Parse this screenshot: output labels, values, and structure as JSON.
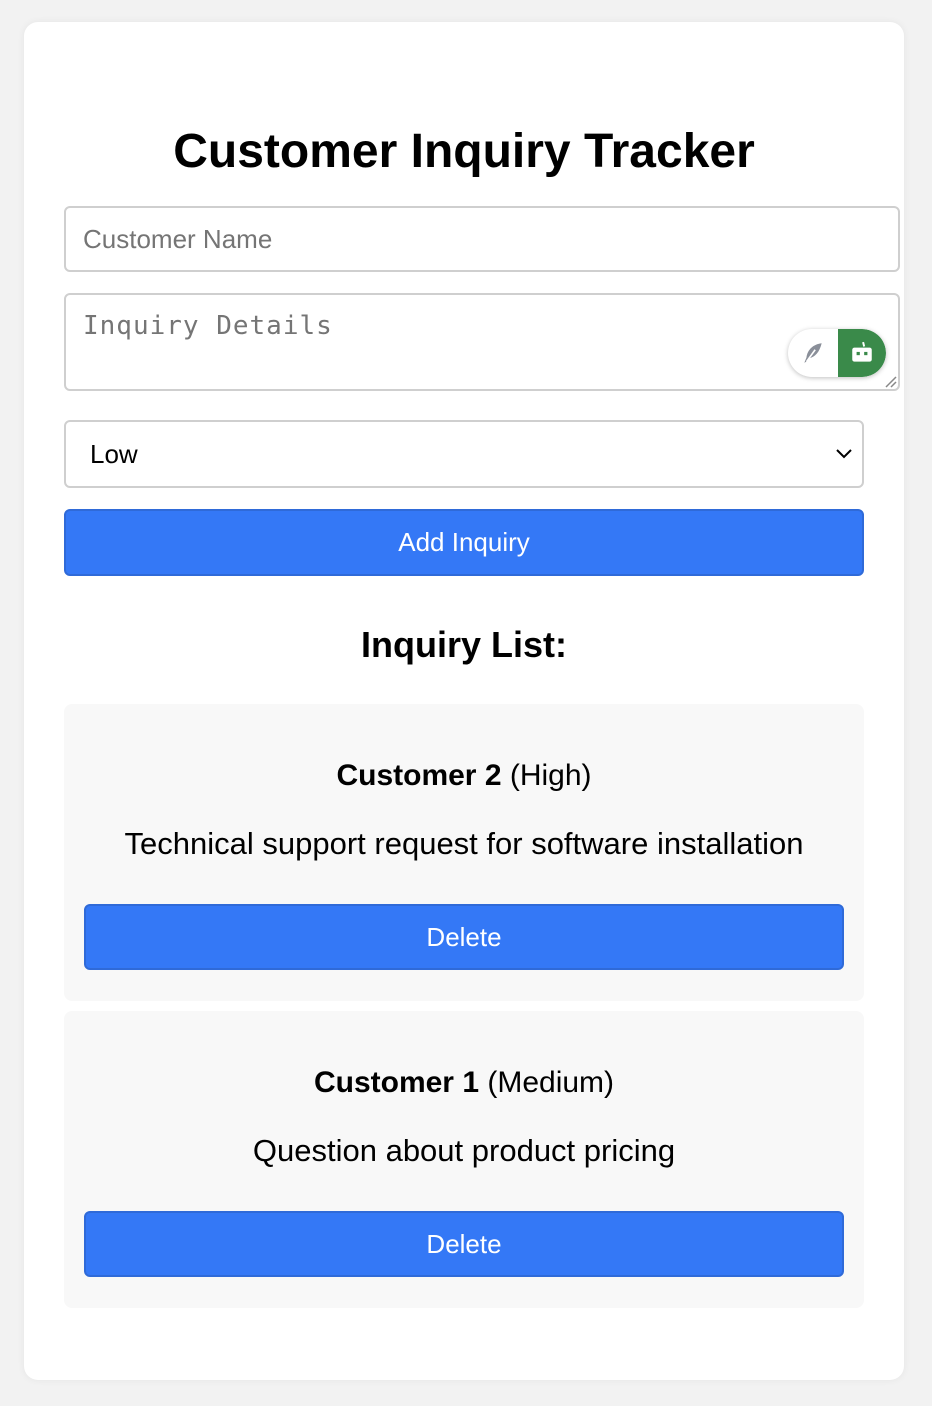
{
  "app": {
    "title": "Customer Inquiry Tracker"
  },
  "form": {
    "name_placeholder": "Customer Name",
    "name_value": "",
    "details_placeholder": "Inquiry Details",
    "details_value": "",
    "priority_selected": "Low",
    "add_label": "Add Inquiry"
  },
  "extension": {
    "left_icon": "feather-icon",
    "right_icon": "robot-icon",
    "accent_color": "#3a8a4a"
  },
  "list": {
    "title": "Inquiry List:",
    "items": [
      {
        "name": "Customer 2",
        "priority": "(High)",
        "details": "Technical support request for software installation",
        "delete_label": "Delete"
      },
      {
        "name": "Customer 1",
        "priority": "(Medium)",
        "details": "Question about product pricing",
        "delete_label": "Delete"
      }
    ]
  },
  "colors": {
    "primary_button": "#3478f6",
    "page_background": "#f2f2f2",
    "card_background": "#ffffff",
    "item_background": "#f8f8f8"
  }
}
